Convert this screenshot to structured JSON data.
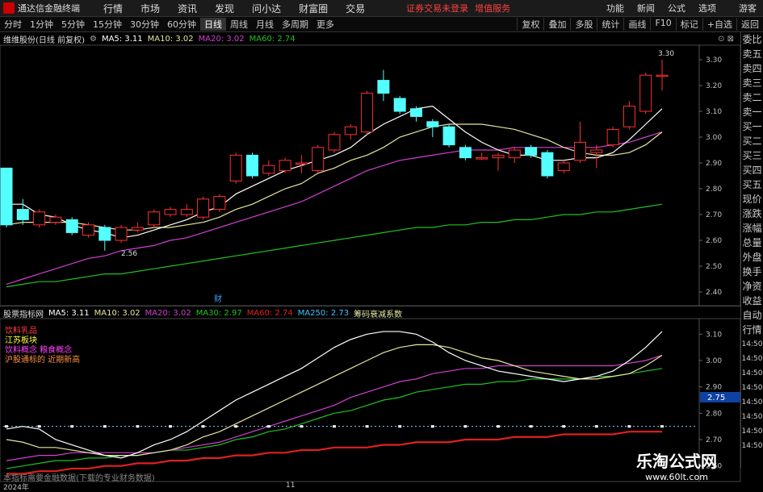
{
  "topbar": {
    "app_title": "通达信金融终端",
    "menus": [
      "行情",
      "市场",
      "资讯",
      "发现",
      "问小达",
      "财富圈",
      "交易"
    ],
    "notice": "证券交易未登录",
    "notice2": "增值服务",
    "right_items": [
      "功能",
      "新闻",
      "公式",
      "选项",
      "游客"
    ]
  },
  "toolbar": {
    "periods": [
      "分时",
      "1分钟",
      "5分钟",
      "15分钟",
      "30分钟",
      "60分钟",
      "日线",
      "周线",
      "月线",
      "多周期",
      "更多"
    ],
    "active_period": "日线",
    "right_items": [
      "复权",
      "叠加",
      "多股",
      "统计",
      "画线",
      "F10",
      "标记",
      "+自选",
      "返回"
    ]
  },
  "main_header": {
    "stock": "维维股份(日线 前复权)",
    "ma5": "MA5: 3.11",
    "ma10": "MA10: 3.02",
    "ma20": "MA20: 3.02",
    "ma60": "MA60: 2.74"
  },
  "price_axis": [
    "3.30",
    "3.20",
    "3.10",
    "3.00",
    "2.90",
    "2.80",
    "2.70",
    "2.60",
    "2.50",
    "2.40"
  ],
  "annotations": {
    "high": "3.30",
    "low": "2.56",
    "cai": "财"
  },
  "sub_header": {
    "name": "股票指标网",
    "ma5": "MA5: 3.11",
    "ma10": "MA10: 3.02",
    "ma20": "MA20: 3.02",
    "ma30": "MA30: 2.97",
    "ma60": "MA60: 2.74",
    "ma250": "MA250: 2.73",
    "extra": "筹码衰减系数"
  },
  "sub_legend": [
    "饮料乳品",
    "江苏板块",
    "饮料概念  粮食概念",
    "沪股通标的 近期新高"
  ],
  "sub_axis": [
    "3.10",
    "3.00",
    "2.90",
    "2.80",
    "2.70",
    "2.60"
  ],
  "sub_marker": "2.75",
  "right_panel": [
    "委比",
    "卖五",
    "卖四",
    "卖三",
    "卖二",
    "卖一",
    "买一",
    "买二",
    "买三",
    "买四",
    "买五",
    "现价",
    "涨跌",
    "涨幅",
    "总量",
    "外盘",
    "换手",
    "净资",
    "收益",
    "自动",
    "行情",
    "14:50",
    "14:50",
    "14:50",
    "14:50",
    "14:50",
    "14:50",
    "14:50",
    "14:50"
  ],
  "bottom_note": "本指标需要金融数据(下载的专业财务数据)",
  "bottom_axis": {
    "year": "2024年",
    "month": "11"
  },
  "watermark": {
    "title": "乐淘公式网",
    "url": "www.60lt.com"
  },
  "colors": {
    "up": "#ff3030",
    "down": "#54ffff",
    "ma5": "#ffffff",
    "ma10": "#e6e6a0",
    "ma20": "#d040d0",
    "ma60": "#22c022",
    "ma250": "#e02020"
  },
  "chart_data": {
    "type": "candlestick",
    "ylim": [
      2.35,
      3.35
    ],
    "candles": [
      {
        "o": 2.88,
        "c": 2.66,
        "h": 2.88,
        "l": 2.65
      },
      {
        "o": 2.72,
        "c": 2.68,
        "h": 2.76,
        "l": 2.66
      },
      {
        "o": 2.66,
        "c": 2.71,
        "h": 2.72,
        "l": 2.65
      },
      {
        "o": 2.67,
        "c": 2.69,
        "h": 2.7,
        "l": 2.66
      },
      {
        "o": 2.68,
        "c": 2.63,
        "h": 2.69,
        "l": 2.62
      },
      {
        "o": 2.62,
        "c": 2.66,
        "h": 2.67,
        "l": 2.61
      },
      {
        "o": 2.65,
        "c": 2.6,
        "h": 2.66,
        "l": 2.56
      },
      {
        "o": 2.6,
        "c": 2.65,
        "h": 2.66,
        "l": 2.59
      },
      {
        "o": 2.64,
        "c": 2.65,
        "h": 2.67,
        "l": 2.63
      },
      {
        "o": 2.66,
        "c": 2.71,
        "h": 2.72,
        "l": 2.65
      },
      {
        "o": 2.7,
        "c": 2.72,
        "h": 2.73,
        "l": 2.69
      },
      {
        "o": 2.7,
        "c": 2.72,
        "h": 2.74,
        "l": 2.69
      },
      {
        "o": 2.69,
        "c": 2.76,
        "h": 2.77,
        "l": 2.68
      },
      {
        "o": 2.72,
        "c": 2.77,
        "h": 2.78,
        "l": 2.71
      },
      {
        "o": 2.83,
        "c": 2.93,
        "h": 2.94,
        "l": 2.82
      },
      {
        "o": 2.93,
        "c": 2.85,
        "h": 2.94,
        "l": 2.84
      },
      {
        "o": 2.86,
        "c": 2.89,
        "h": 2.91,
        "l": 2.85
      },
      {
        "o": 2.87,
        "c": 2.91,
        "h": 2.92,
        "l": 2.86
      },
      {
        "o": 2.9,
        "c": 2.9,
        "h": 2.93,
        "l": 2.86
      },
      {
        "o": 2.87,
        "c": 2.96,
        "h": 2.97,
        "l": 2.86
      },
      {
        "o": 2.95,
        "c": 3.01,
        "h": 3.02,
        "l": 2.94
      },
      {
        "o": 3.01,
        "c": 3.04,
        "h": 3.05,
        "l": 2.99
      },
      {
        "o": 3.02,
        "c": 3.17,
        "h": 3.18,
        "l": 3.01
      },
      {
        "o": 3.22,
        "c": 3.17,
        "h": 3.26,
        "l": 3.14
      },
      {
        "o": 3.15,
        "c": 3.1,
        "h": 3.16,
        "l": 3.09
      },
      {
        "o": 3.11,
        "c": 3.08,
        "h": 3.12,
        "l": 3.06
      },
      {
        "o": 3.06,
        "c": 3.04,
        "h": 3.07,
        "l": 3.0
      },
      {
        "o": 3.04,
        "c": 2.97,
        "h": 3.05,
        "l": 2.96
      },
      {
        "o": 2.96,
        "c": 2.92,
        "h": 2.97,
        "l": 2.91
      },
      {
        "o": 2.92,
        "c": 2.92,
        "h": 2.94,
        "l": 2.91
      },
      {
        "o": 2.92,
        "c": 2.93,
        "h": 2.94,
        "l": 2.87
      },
      {
        "o": 2.92,
        "c": 2.95,
        "h": 2.96,
        "l": 2.9
      },
      {
        "o": 2.96,
        "c": 2.93,
        "h": 2.97,
        "l": 2.92
      },
      {
        "o": 2.94,
        "c": 2.85,
        "h": 2.95,
        "l": 2.84
      },
      {
        "o": 2.87,
        "c": 2.9,
        "h": 2.91,
        "l": 2.86
      },
      {
        "o": 2.91,
        "c": 2.98,
        "h": 3.06,
        "l": 2.9
      },
      {
        "o": 2.94,
        "c": 2.95,
        "h": 2.97,
        "l": 2.88
      },
      {
        "o": 2.97,
        "c": 3.03,
        "h": 3.04,
        "l": 2.96
      },
      {
        "o": 3.04,
        "c": 3.12,
        "h": 3.14,
        "l": 3.03
      },
      {
        "o": 3.1,
        "c": 3.24,
        "h": 3.25,
        "l": 3.09
      },
      {
        "o": 3.24,
        "c": 3.24,
        "h": 3.3,
        "l": 3.18
      }
    ],
    "ma5": [
      2.74,
      2.74,
      2.7,
      2.69,
      2.66,
      2.64,
      2.63,
      2.61,
      2.62,
      2.64,
      2.66,
      2.68,
      2.71,
      2.73,
      2.78,
      2.81,
      2.84,
      2.87,
      2.89,
      2.91,
      2.93,
      2.96,
      3.01,
      3.05,
      3.08,
      3.11,
      3.12,
      3.07,
      3.02,
      2.98,
      2.95,
      2.93,
      2.93,
      2.91,
      2.91,
      2.92,
      2.92,
      2.94,
      2.99,
      3.05,
      3.11
    ],
    "ma10": [
      2.66,
      2.67,
      2.67,
      2.67,
      2.67,
      2.66,
      2.65,
      2.64,
      2.64,
      2.65,
      2.65,
      2.66,
      2.67,
      2.69,
      2.72,
      2.74,
      2.77,
      2.8,
      2.82,
      2.86,
      2.88,
      2.91,
      2.93,
      2.96,
      3.0,
      3.02,
      3.04,
      3.05,
      3.05,
      3.05,
      3.04,
      3.03,
      3.01,
      2.99,
      2.96,
      2.94,
      2.93,
      2.93,
      2.94,
      2.97,
      3.02
    ],
    "ma20": [
      2.43,
      2.45,
      2.47,
      2.49,
      2.51,
      2.53,
      2.54,
      2.56,
      2.57,
      2.58,
      2.6,
      2.61,
      2.63,
      2.65,
      2.67,
      2.69,
      2.71,
      2.73,
      2.75,
      2.78,
      2.81,
      2.84,
      2.87,
      2.89,
      2.91,
      2.92,
      2.93,
      2.94,
      2.95,
      2.95,
      2.95,
      2.96,
      2.96,
      2.96,
      2.96,
      2.96,
      2.96,
      2.97,
      2.98,
      3.0,
      3.02
    ],
    "ma60": [
      2.42,
      2.43,
      2.44,
      2.44,
      2.45,
      2.46,
      2.47,
      2.47,
      2.48,
      2.49,
      2.5,
      2.51,
      2.52,
      2.53,
      2.54,
      2.55,
      2.56,
      2.57,
      2.58,
      2.59,
      2.6,
      2.61,
      2.62,
      2.63,
      2.64,
      2.65,
      2.65,
      2.66,
      2.66,
      2.67,
      2.67,
      2.68,
      2.68,
      2.69,
      2.7,
      2.7,
      2.71,
      2.71,
      2.72,
      2.73,
      2.74
    ]
  },
  "sub_chart_data": {
    "ylim": [
      2.55,
      3.15
    ],
    "ma5": [
      2.74,
      2.75,
      2.74,
      2.7,
      2.68,
      2.66,
      2.64,
      2.63,
      2.65,
      2.68,
      2.7,
      2.73,
      2.77,
      2.81,
      2.85,
      2.88,
      2.91,
      2.94,
      2.97,
      3.01,
      3.05,
      3.08,
      3.1,
      3.11,
      3.11,
      3.1,
      3.07,
      3.03,
      3.0,
      2.98,
      2.96,
      2.95,
      2.94,
      2.93,
      2.92,
      2.93,
      2.94,
      2.96,
      3.0,
      3.05,
      3.11
    ],
    "ma10": [
      2.7,
      2.69,
      2.67,
      2.67,
      2.66,
      2.65,
      2.64,
      2.64,
      2.64,
      2.65,
      2.66,
      2.68,
      2.71,
      2.73,
      2.76,
      2.79,
      2.82,
      2.85,
      2.88,
      2.91,
      2.94,
      2.97,
      3.0,
      3.03,
      3.05,
      3.06,
      3.06,
      3.05,
      3.03,
      3.01,
      3.0,
      2.98,
      2.96,
      2.95,
      2.94,
      2.93,
      2.93,
      2.94,
      2.95,
      2.98,
      3.02
    ],
    "ma20": [
      2.62,
      2.63,
      2.64,
      2.64,
      2.65,
      2.65,
      2.65,
      2.65,
      2.65,
      2.65,
      2.66,
      2.67,
      2.68,
      2.69,
      2.71,
      2.73,
      2.75,
      2.77,
      2.79,
      2.81,
      2.83,
      2.86,
      2.88,
      2.9,
      2.92,
      2.93,
      2.95,
      2.96,
      2.97,
      2.97,
      2.98,
      2.98,
      2.98,
      2.98,
      2.98,
      2.98,
      2.98,
      2.98,
      2.99,
      3.0,
      3.02
    ],
    "ma30": [
      2.59,
      2.6,
      2.61,
      2.62,
      2.62,
      2.63,
      2.63,
      2.64,
      2.64,
      2.65,
      2.66,
      2.66,
      2.67,
      2.68,
      2.7,
      2.71,
      2.73,
      2.74,
      2.76,
      2.78,
      2.8,
      2.81,
      2.83,
      2.85,
      2.86,
      2.88,
      2.89,
      2.9,
      2.91,
      2.91,
      2.92,
      2.92,
      2.93,
      2.93,
      2.93,
      2.93,
      2.94,
      2.94,
      2.95,
      2.96,
      2.97
    ],
    "ma250": [
      2.57,
      2.57,
      2.58,
      2.58,
      2.59,
      2.59,
      2.6,
      2.6,
      2.61,
      2.61,
      2.62,
      2.62,
      2.63,
      2.63,
      2.64,
      2.64,
      2.65,
      2.65,
      2.66,
      2.66,
      2.67,
      2.67,
      2.67,
      2.68,
      2.68,
      2.69,
      2.69,
      2.69,
      2.7,
      2.7,
      2.7,
      2.71,
      2.71,
      2.71,
      2.72,
      2.72,
      2.72,
      2.72,
      2.73,
      2.73,
      2.73
    ],
    "dots_level": 2.75
  }
}
